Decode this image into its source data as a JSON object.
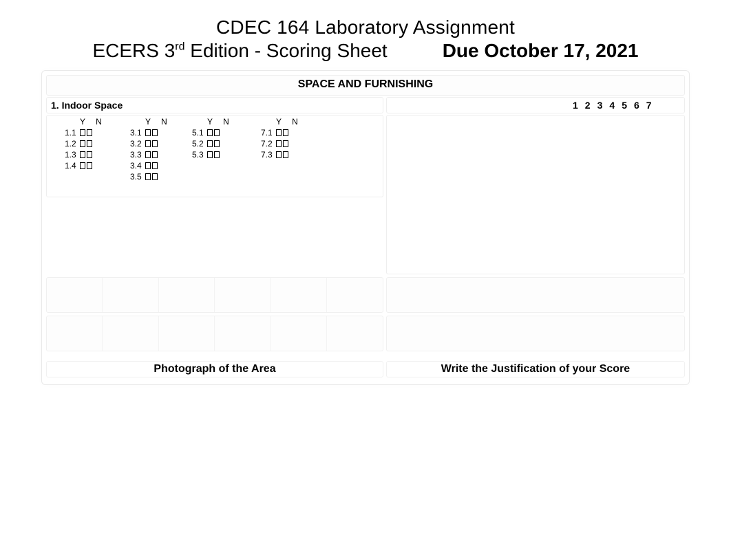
{
  "title_line1": "CDEC 164 Laboratory Assignment",
  "title_line2_prefix": "ECERS 3",
  "title_line2_sup": "rd",
  "title_line2_suffix": " Edition - Scoring Sheet",
  "due": "Due October 17, 2021",
  "section_header": "SPACE AND FURNISHING",
  "item_title": "1. Indoor Space",
  "scale": [
    "1",
    "2",
    "3",
    "4",
    "5",
    "6",
    "7"
  ],
  "yn_header": "Y  N",
  "cols": {
    "c1": [
      "1.1",
      "1.2",
      "1.3",
      "1.4"
    ],
    "c3": [
      "3.1",
      "3.2",
      "3.3",
      "3.4",
      "3.5"
    ],
    "c5": [
      "5.1",
      "5.2",
      "5.3"
    ],
    "c7": [
      "7.1",
      "7.2",
      "7.3"
    ]
  },
  "caption_left": "Photograph of the Area",
  "caption_right": "Write the Justification of your Score"
}
